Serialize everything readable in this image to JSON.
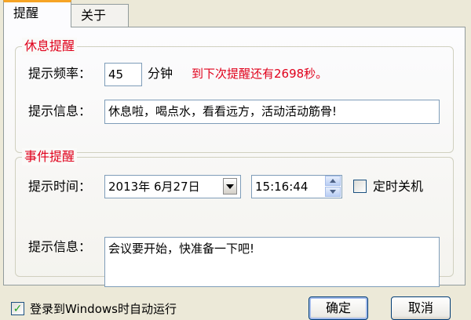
{
  "tabs": [
    {
      "label": "提醒"
    },
    {
      "label": "关于"
    }
  ],
  "rest_group": {
    "title": "休息提醒",
    "frequency_label": "提示频率：",
    "frequency_value": "45",
    "frequency_unit": "分钟",
    "countdown": "到下次提醒还有2698秒。",
    "message_label": "提示信息：",
    "message_value": "休息啦，喝点水，看看远方，活动活动筋骨!"
  },
  "event_group": {
    "title": "事件提醒",
    "time_label": "提示时间：",
    "date_value": "2013年 6月27日",
    "time_value": "15:16:44",
    "shutdown_label": "定时关机",
    "shutdown_checked": false,
    "message_label": "提示信息：",
    "message_value": "会议要开始，快准备一下吧!"
  },
  "footer": {
    "autostart_label": "登录到Windows时自动运行",
    "autostart_checked": true,
    "ok_label": "确定",
    "cancel_label": "取消"
  },
  "colors": {
    "accent_red": "#E0001B",
    "active_tab_top": "#F6A425"
  }
}
